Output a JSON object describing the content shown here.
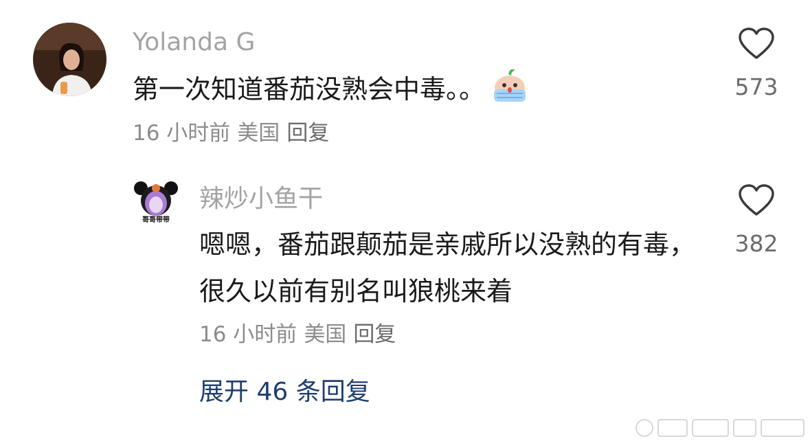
{
  "comments": [
    {
      "username": "Yolanda G",
      "text": "第一次知道番茄没熟会中毒。。",
      "emoji": "crying-face-emoji",
      "time": "16 小时前",
      "location": "美国",
      "reply_label": "回复",
      "likes": "573"
    }
  ],
  "reply": {
    "username": "辣炒小鱼干",
    "avatar_caption": "哥哥带带",
    "text": "嗯嗯，番茄跟颠茄是亲戚所以没熟的有毒，很久以前有别名叫狼桃来着",
    "time": "16 小时前",
    "location": "美国",
    "reply_label": "回复",
    "likes": "382"
  },
  "expand_replies": "展开 46 条回复",
  "colors": {
    "username": "#a3a3a3",
    "text": "#1a1a1a",
    "meta": "#8c8c8c",
    "link": "#1e3e6e"
  }
}
